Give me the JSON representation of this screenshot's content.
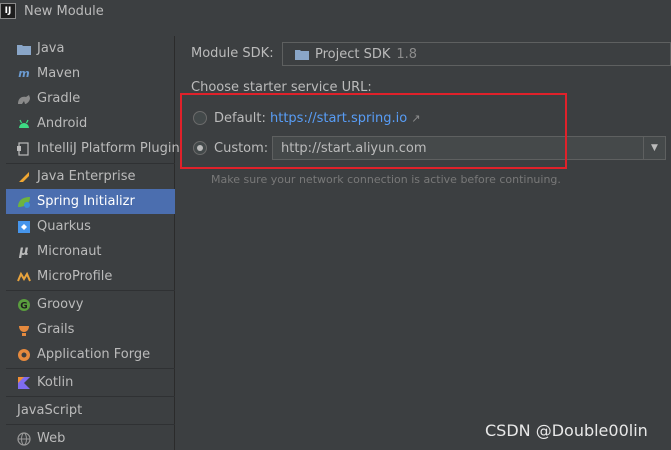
{
  "window": {
    "title": "New Module",
    "icon_text": "IJ"
  },
  "sidebar": {
    "items": [
      {
        "label": "Java",
        "icon": "folder-icon",
        "color": "#6b9bd1"
      },
      {
        "label": "Maven",
        "icon": "maven-icon",
        "color": "#6b9bd1"
      },
      {
        "label": "Gradle",
        "icon": "gradle-icon",
        "color": "#8a8a8a"
      },
      {
        "label": "Android",
        "icon": "android-icon",
        "color": "#3ddc84"
      },
      {
        "label": "IntelliJ Platform Plugin",
        "icon": "plugin-icon",
        "color": "#bbbbbb"
      },
      {
        "label": "Java Enterprise",
        "icon": "java-enterprise-icon",
        "color": "#f0a732"
      },
      {
        "label": "Spring Initializr",
        "icon": "spring-icon",
        "color": "#6db33f"
      },
      {
        "label": "Quarkus",
        "icon": "quarkus-icon",
        "color": "#4695eb"
      },
      {
        "label": "Micronaut",
        "icon": "micronaut-icon",
        "color": "#bbbbbb"
      },
      {
        "label": "MicroProfile",
        "icon": "microprofile-icon",
        "color": "#e8a33d"
      },
      {
        "label": "Groovy",
        "icon": "groovy-icon",
        "color": "#5a9e3e"
      },
      {
        "label": "Grails",
        "icon": "grails-icon",
        "color": "#e68a3e"
      },
      {
        "label": "Application Forge",
        "icon": "forge-icon",
        "color": "#e68a3e"
      },
      {
        "label": "Kotlin",
        "icon": "kotlin-icon",
        "color": "#7f6cf0"
      },
      {
        "label": "JavaScript",
        "icon": "",
        "color": ""
      },
      {
        "label": "Web",
        "icon": "globe-icon",
        "color": "#8a8a8a"
      }
    ],
    "selected": "Spring Initializr"
  },
  "form": {
    "sdk_label": "Module SDK:",
    "sdk_value": "Project SDK",
    "sdk_version": "1.8",
    "url_section_label": "Choose starter service URL:",
    "default_label": "Default:",
    "default_url": "https://start.spring.io",
    "default_url_arrow": "↗",
    "custom_label": "Custom:",
    "custom_url": "http://start.aliyun.com",
    "selected_option": "custom",
    "hint": "Make sure your network connection is active before continuing."
  },
  "watermark": "CSDN @Double00lin",
  "colors": {
    "selection": "#4b6eaf",
    "link": "#589df6",
    "highlight_box": "#e0212a"
  }
}
